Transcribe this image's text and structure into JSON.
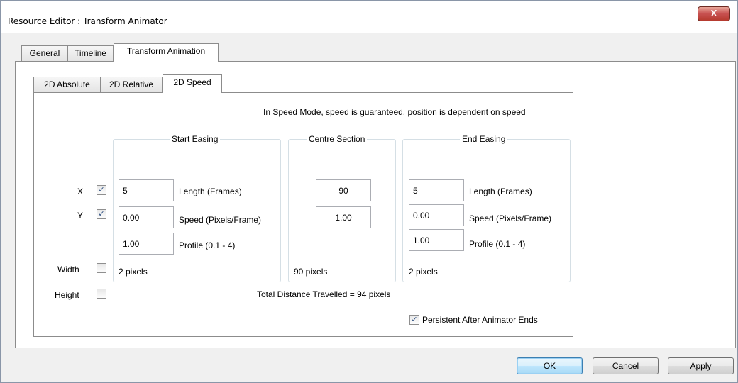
{
  "window": {
    "title": "Resource Editor  :  Transform Animator",
    "close_glyph": "X"
  },
  "main_tabs": [
    {
      "label": "General",
      "active": false
    },
    {
      "label": "Timeline",
      "active": false
    },
    {
      "label": "Transform Animation",
      "active": true
    }
  ],
  "sub_tabs": [
    {
      "label": "2D Absolute",
      "active": false
    },
    {
      "label": "2D Relative",
      "active": false
    },
    {
      "label": "2D Speed",
      "active": true
    }
  ],
  "info_text": "In Speed Mode, speed is guaranteed, position is dependent on speed",
  "axes": {
    "x": {
      "label": "X",
      "checked": true
    },
    "y": {
      "label": "Y",
      "checked": true
    },
    "width": {
      "label": "Width",
      "checked": false
    },
    "height": {
      "label": "Height",
      "checked": false
    }
  },
  "start_easing": {
    "title": "Start Easing",
    "length_value": "5",
    "length_label": "Length (Frames)",
    "speed_value": "0.00",
    "speed_label": "Speed (Pixels/Frame)",
    "profile_value": "1.00",
    "profile_label": "Profile (0.1 - 4)",
    "distance": "2 pixels"
  },
  "centre_section": {
    "title": "Centre Section",
    "length_value": "90",
    "speed_value": "1.00",
    "distance": "90 pixels"
  },
  "end_easing": {
    "title": "End Easing",
    "length_value": "5",
    "length_label": "Length (Frames)",
    "speed_value": "0.00",
    "speed_label": "Speed (Pixels/Frame)",
    "profile_value": "1.00",
    "profile_label": "Profile (0.1 - 4)",
    "distance": "2 pixels"
  },
  "total_distance": "Total Distance Travelled = 94 pixels",
  "persistent": {
    "label": "Persistent After Animator Ends",
    "checked": true
  },
  "buttons": {
    "ok": "OK",
    "cancel": "Cancel",
    "apply": "Apply"
  },
  "check_glyph": "✓"
}
